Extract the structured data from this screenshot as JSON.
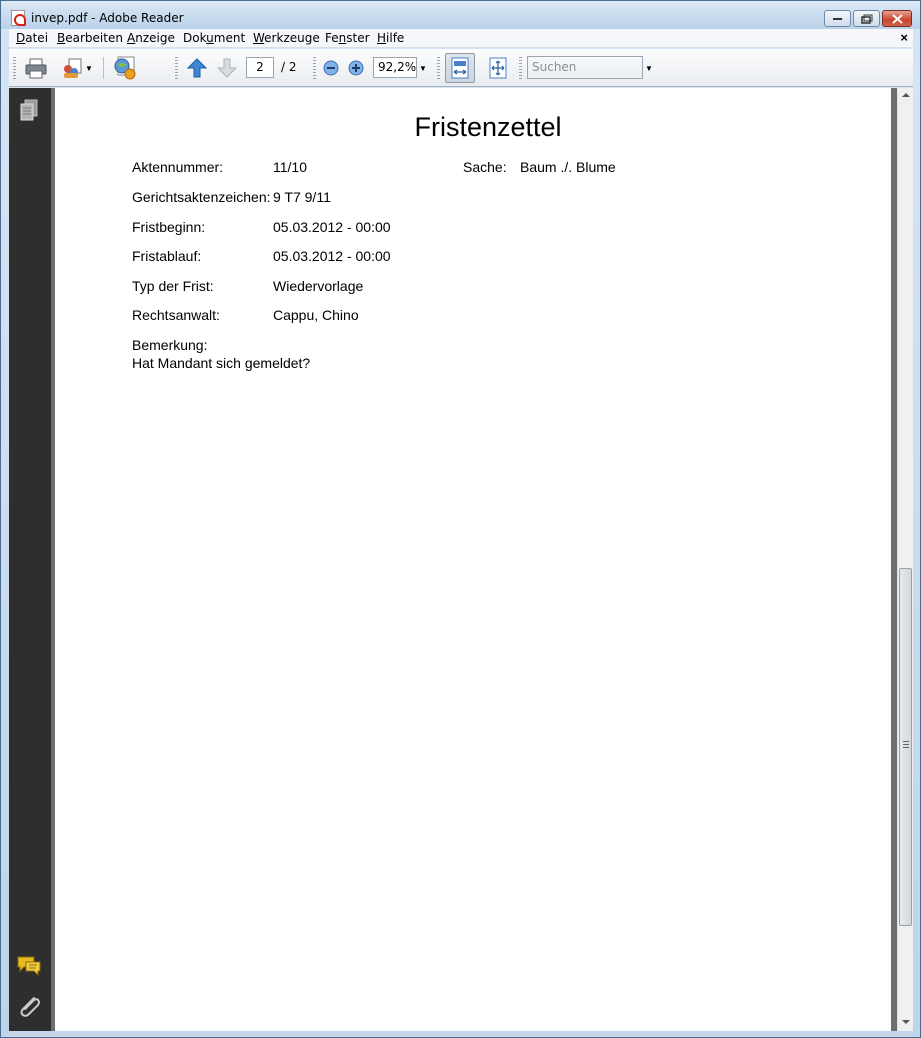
{
  "window": {
    "title": "invep.pdf - Adobe Reader",
    "minimize": "–",
    "maximize": "□",
    "close": "✕"
  },
  "menu": {
    "items": [
      {
        "label": "Datei",
        "accel": "D",
        "rest": "atei"
      },
      {
        "label": "Bearbeiten",
        "accel": "B",
        "rest": "earbeiten"
      },
      {
        "label": "Anzeige",
        "accel": "A",
        "rest": "nzeige"
      },
      {
        "label": "Dokument",
        "pre": "Dok",
        "accel": "u",
        "rest": "ment"
      },
      {
        "label": "Werkzeuge",
        "accel": "W",
        "rest": "erkzeuge"
      },
      {
        "label": "Fenster",
        "pre": "Fe",
        "accel": "n",
        "rest": "ster"
      },
      {
        "label": "Hilfe",
        "accel": "H",
        "rest": "ilfe"
      }
    ],
    "close_doc": "×"
  },
  "toolbar": {
    "current_page": "2",
    "total_pages": "/  2",
    "zoom": "92,2%",
    "search_placeholder": "Suchen"
  },
  "icons": {
    "print": "print-icon",
    "collaborate": "collaborate-icon",
    "share": "share-icon",
    "prev_page": "arrow-up-icon",
    "next_page": "arrow-down-icon",
    "zoom_out": "zoom-out-icon",
    "zoom_in": "zoom-in-icon",
    "fit_width": "fit-width-icon",
    "fit_page": "fit-page-icon",
    "pages_panel": "pages-icon",
    "comments": "comments-icon",
    "attachments": "paperclip-icon"
  },
  "colors": {
    "arrow_blue": "#3d86d6",
    "nav_panel": "#2e2e2e",
    "comment_yellow": "#e8b820"
  },
  "document": {
    "title": "Fristenzettel",
    "fields": [
      {
        "label": "Aktennummer:",
        "value": "11/10"
      },
      {
        "label": "Gerichtsaktenzeichen:",
        "value": "9 T7 9/11"
      },
      {
        "label": "Fristbeginn:",
        "value": "05.03.2012 - 00:00"
      },
      {
        "label": "Fristablauf:",
        "value": "05.03.2012 - 00:00"
      },
      {
        "label": "Typ der Frist:",
        "value": "Wiedervorlage"
      },
      {
        "label": "Rechtsanwalt:",
        "value": "Cappu, Chino"
      }
    ],
    "sache_label": "Sache:",
    "sache_value": "Baum ./. Blume",
    "bemerkung_label": "Bemerkung:",
    "bemerkung_text": "Hat Mandant sich gemeldet?"
  }
}
